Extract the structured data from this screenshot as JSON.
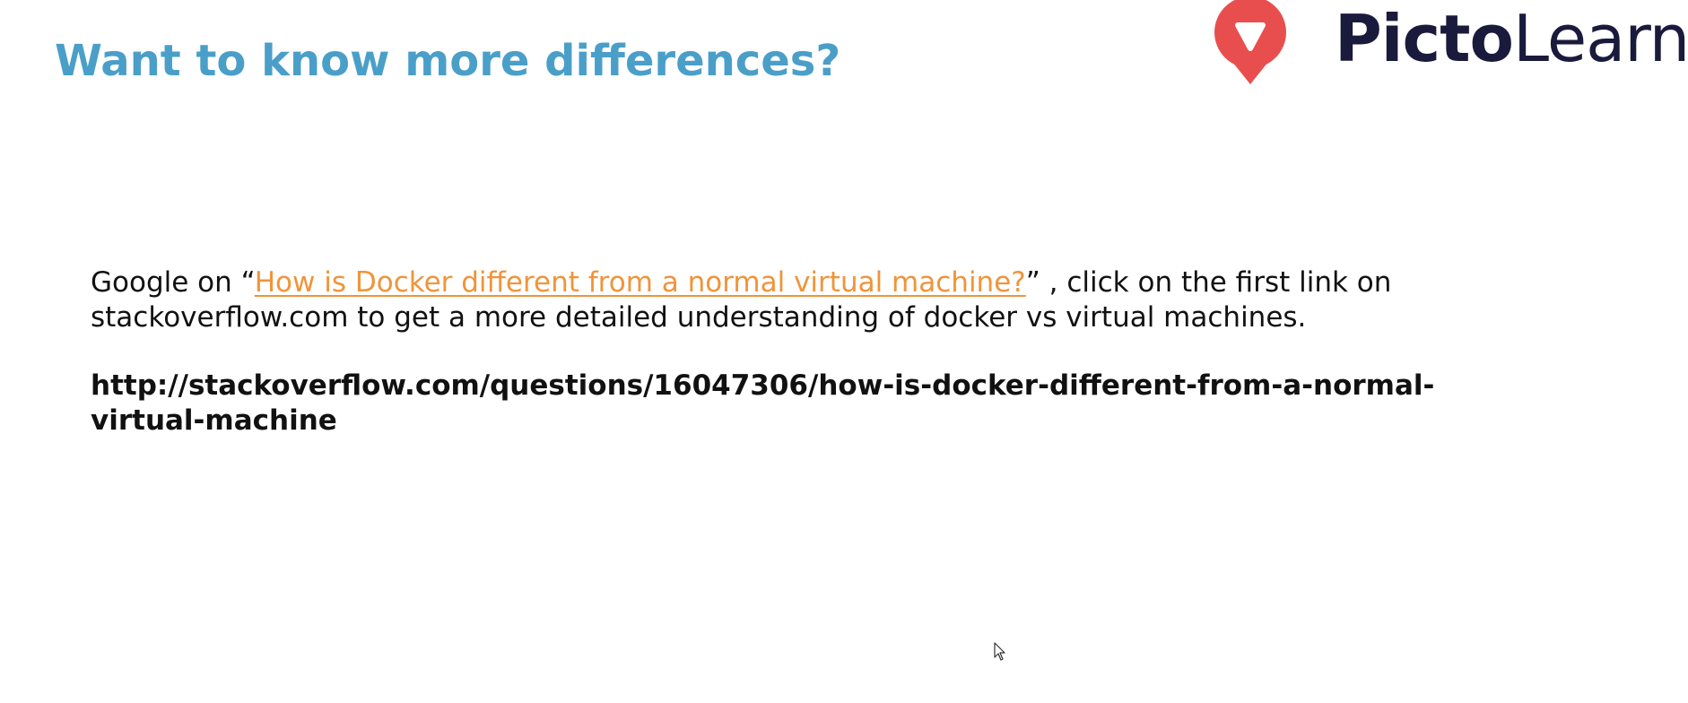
{
  "slide": {
    "title": "Want to know more differences?"
  },
  "logo": {
    "text_bold": "Picto",
    "text_regular": "Learn",
    "icon": "pictolearn-pin-logo-icon",
    "brand_color": "#e94e4e",
    "text_color": "#1a1a3d"
  },
  "content": {
    "prefix": "Google on “",
    "link_text": "How is Docker different from a normal virtual machine?",
    "suffix": "” , click on the first link on stackoverflow.com to get a more detailed understanding of docker vs virtual machines.",
    "url_line1": "http://stackoverflow.com/questions/16047306/how-is-docker-different-from-a-normal-",
    "url_line2": "virtual-machine"
  },
  "colors": {
    "title": "#4a9fc9",
    "link": "#f0943a",
    "body": "#111111"
  },
  "cursor": {
    "icon": "mouse-pointer-icon"
  }
}
